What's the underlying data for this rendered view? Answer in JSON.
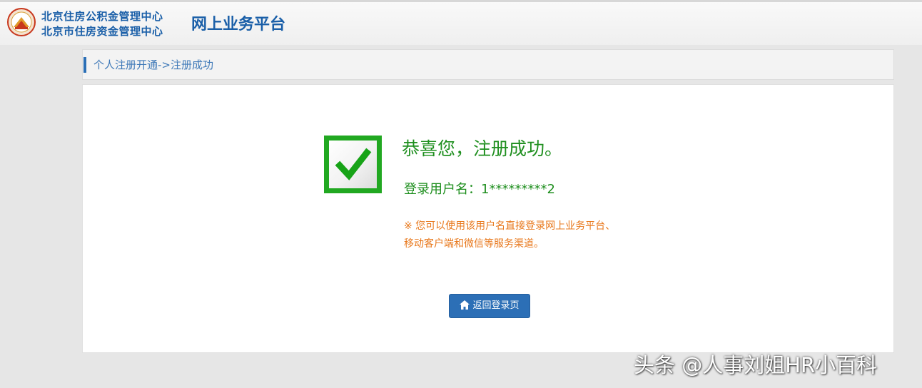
{
  "header": {
    "org_name_1": "北京住房公积金管理中心",
    "org_name_2": "北京市住房资金管理中心",
    "platform_title": "网上业务平台",
    "logo_icon": "beijing-housing-fund-logo",
    "brand_color": "#1a5fa8"
  },
  "breadcrumb": {
    "text": "个人注册开通->注册成功"
  },
  "result": {
    "status_icon": "green-checkmark-icon",
    "title": "恭喜您，注册成功。",
    "username_line": "登录用户名：1*********2",
    "note_line_1": "※ 您可以使用该用户名直接登录网上业务平台、",
    "note_line_2": "移动客户端和微信等服务渠道。",
    "success_color": "#1f8f1f",
    "note_color": "#e8781c"
  },
  "actions": {
    "back_label": "返回登录页",
    "back_icon": "home-icon",
    "button_color": "#2c6fb6"
  },
  "watermark": {
    "text": "头条 @人事刘姐HR小百科"
  }
}
